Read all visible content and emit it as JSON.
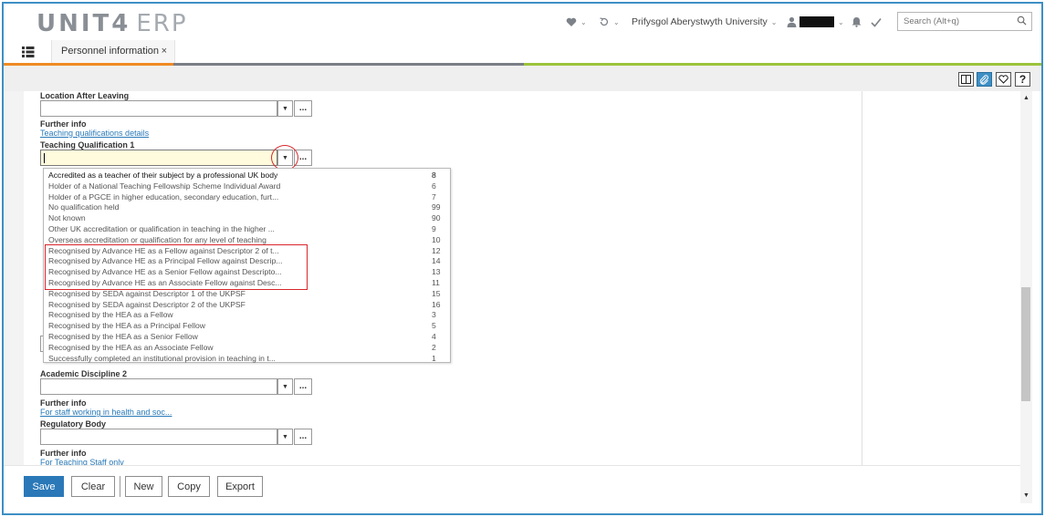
{
  "header": {
    "logo_main": "UNIT4",
    "logo_sub": "ERP",
    "organisation": "Prifysgol Aberystwyth University",
    "search_placeholder": "Search (Alt+q)"
  },
  "tabs": [
    {
      "label": "Personnel information",
      "close": "×"
    }
  ],
  "colors": {
    "accent": "#3d8fc4",
    "bar_orange": "#f08a24",
    "bar_grey": "#7a7f86",
    "bar_green": "#9bc33c",
    "highlight_red": "#d8262c",
    "focus_yellow": "#fffbdc"
  },
  "icons": {
    "menu": "grid-menu-icon",
    "favourites": "heart-icon",
    "history": "history-icon",
    "user": "user-icon",
    "notifications": "bell-icon",
    "tasks": "check-icon",
    "search": "search-icon",
    "toolbar": [
      "split-view-icon",
      "attachment-icon",
      "favourite-icon",
      "help-icon"
    ]
  },
  "toolbar": {
    "help": "?"
  },
  "form": {
    "location_after_leaving": {
      "label": "Location After Leaving",
      "value": ""
    },
    "further_info_1": {
      "label": "Further info",
      "link": "Teaching qualifications details"
    },
    "teaching_qualification_1": {
      "label": "Teaching Qualification 1",
      "value": ""
    },
    "academic_discipline_2": {
      "label": "Academic Discipline 2",
      "value": ""
    },
    "further_info_2": {
      "label": "Further info",
      "link": "For staff working in health and soc..."
    },
    "regulatory_body": {
      "label": "Regulatory Body",
      "value": ""
    },
    "further_info_3": {
      "label": "Further info",
      "link": "For Teaching Staff only"
    },
    "dots": "..."
  },
  "dropdown_options": [
    {
      "text": "Accredited as a teacher of their subject by a professional UK body",
      "code": "8"
    },
    {
      "text": "Holder of a National Teaching Fellowship Scheme Individual Award",
      "code": "6"
    },
    {
      "text": "Holder of a PGCE in higher education, secondary education, furt...",
      "code": "7"
    },
    {
      "text": "No qualification held",
      "code": "99"
    },
    {
      "text": "Not known",
      "code": "90"
    },
    {
      "text": "Other UK accreditation or qualification in teaching in the higher ...",
      "code": "9"
    },
    {
      "text": "Overseas accreditation or qualification for any level of teaching",
      "code": "10"
    },
    {
      "text": "Recognised by Advance HE as a Fellow against Descriptor 2 of t...",
      "code": "12"
    },
    {
      "text": "Recognised by Advance HE as a Principal Fellow against Descrip...",
      "code": "14"
    },
    {
      "text": "Recognised by Advance HE as a Senior Fellow against Descripto...",
      "code": "13"
    },
    {
      "text": "Recognised by Advance HE as an Associate Fellow against Desc...",
      "code": "11"
    },
    {
      "text": "Recognised by SEDA against Descriptor 1 of the UKPSF",
      "code": "15"
    },
    {
      "text": "Recognised by SEDA against Descriptor 2 of the UKPSF",
      "code": "16"
    },
    {
      "text": "Recognised by the HEA as a Fellow",
      "code": "3"
    },
    {
      "text": "Recognised by the HEA as a Principal Fellow",
      "code": "5"
    },
    {
      "text": "Recognised by the HEA as a Senior Fellow",
      "code": "4"
    },
    {
      "text": "Recognised by the HEA as an Associate Fellow",
      "code": "2"
    },
    {
      "text": "Successfully completed an institutional provision in teaching in t...",
      "code": "1"
    }
  ],
  "actions": {
    "save": "Save",
    "clear": "Clear",
    "new": "New",
    "copy": "Copy",
    "export": "Export"
  }
}
